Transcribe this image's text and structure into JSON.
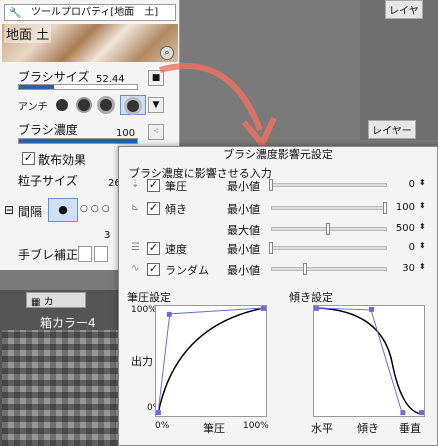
{
  "right_panel": {
    "tab1": "レイヤ",
    "tab2": "レイヤー"
  },
  "tool_property": {
    "title": "ツールプロパティ[地面　土]",
    "texture_label": "地面 土",
    "brush_size_label": "ブラシサイズ",
    "brush_size_value": "52.44",
    "antialias_label": "アンチ",
    "brush_density_label": "ブラシ濃度",
    "brush_density_value": "100",
    "scatter_label": "散布効果",
    "particle_size_label": "粒子サイズ",
    "particle_size_value": "26",
    "spacing_label": "間隔",
    "spacing_value": "3",
    "stabilization_label": "手ブレ補正"
  },
  "color_panel": {
    "tab_label": "カ",
    "set_name": "箱カラー4"
  },
  "dialog": {
    "title": "ブラシ濃度影響元設定",
    "section_label": "ブラシ濃度に影響させる入力",
    "rows": [
      {
        "label": "筆圧",
        "checked": true,
        "param": "最小値",
        "value": "0",
        "level": 0.0
      },
      {
        "label": "傾き",
        "checked": true,
        "param": "最小値",
        "value": "100",
        "level": 1.0
      },
      {
        "label": "",
        "checked": null,
        "param": "最大値",
        "value": "500",
        "level": 0.5
      },
      {
        "label": "速度",
        "checked": true,
        "param": "最小値",
        "value": "0",
        "level": 0.0
      },
      {
        "label": "ランダム",
        "checked": true,
        "param": "最小値",
        "value": "30",
        "level": 0.3
      }
    ],
    "pressure_graph": {
      "title": "筆圧設定",
      "y_label": "出力",
      "y_top": "100%",
      "y_bottom": "0%",
      "x_left": "0%",
      "x_mid": "筆圧",
      "x_right": "100%"
    },
    "tilt_graph": {
      "title": "傾き設定",
      "x_left": "水平",
      "x_mid": "傾き",
      "x_right": "垂直"
    }
  }
}
